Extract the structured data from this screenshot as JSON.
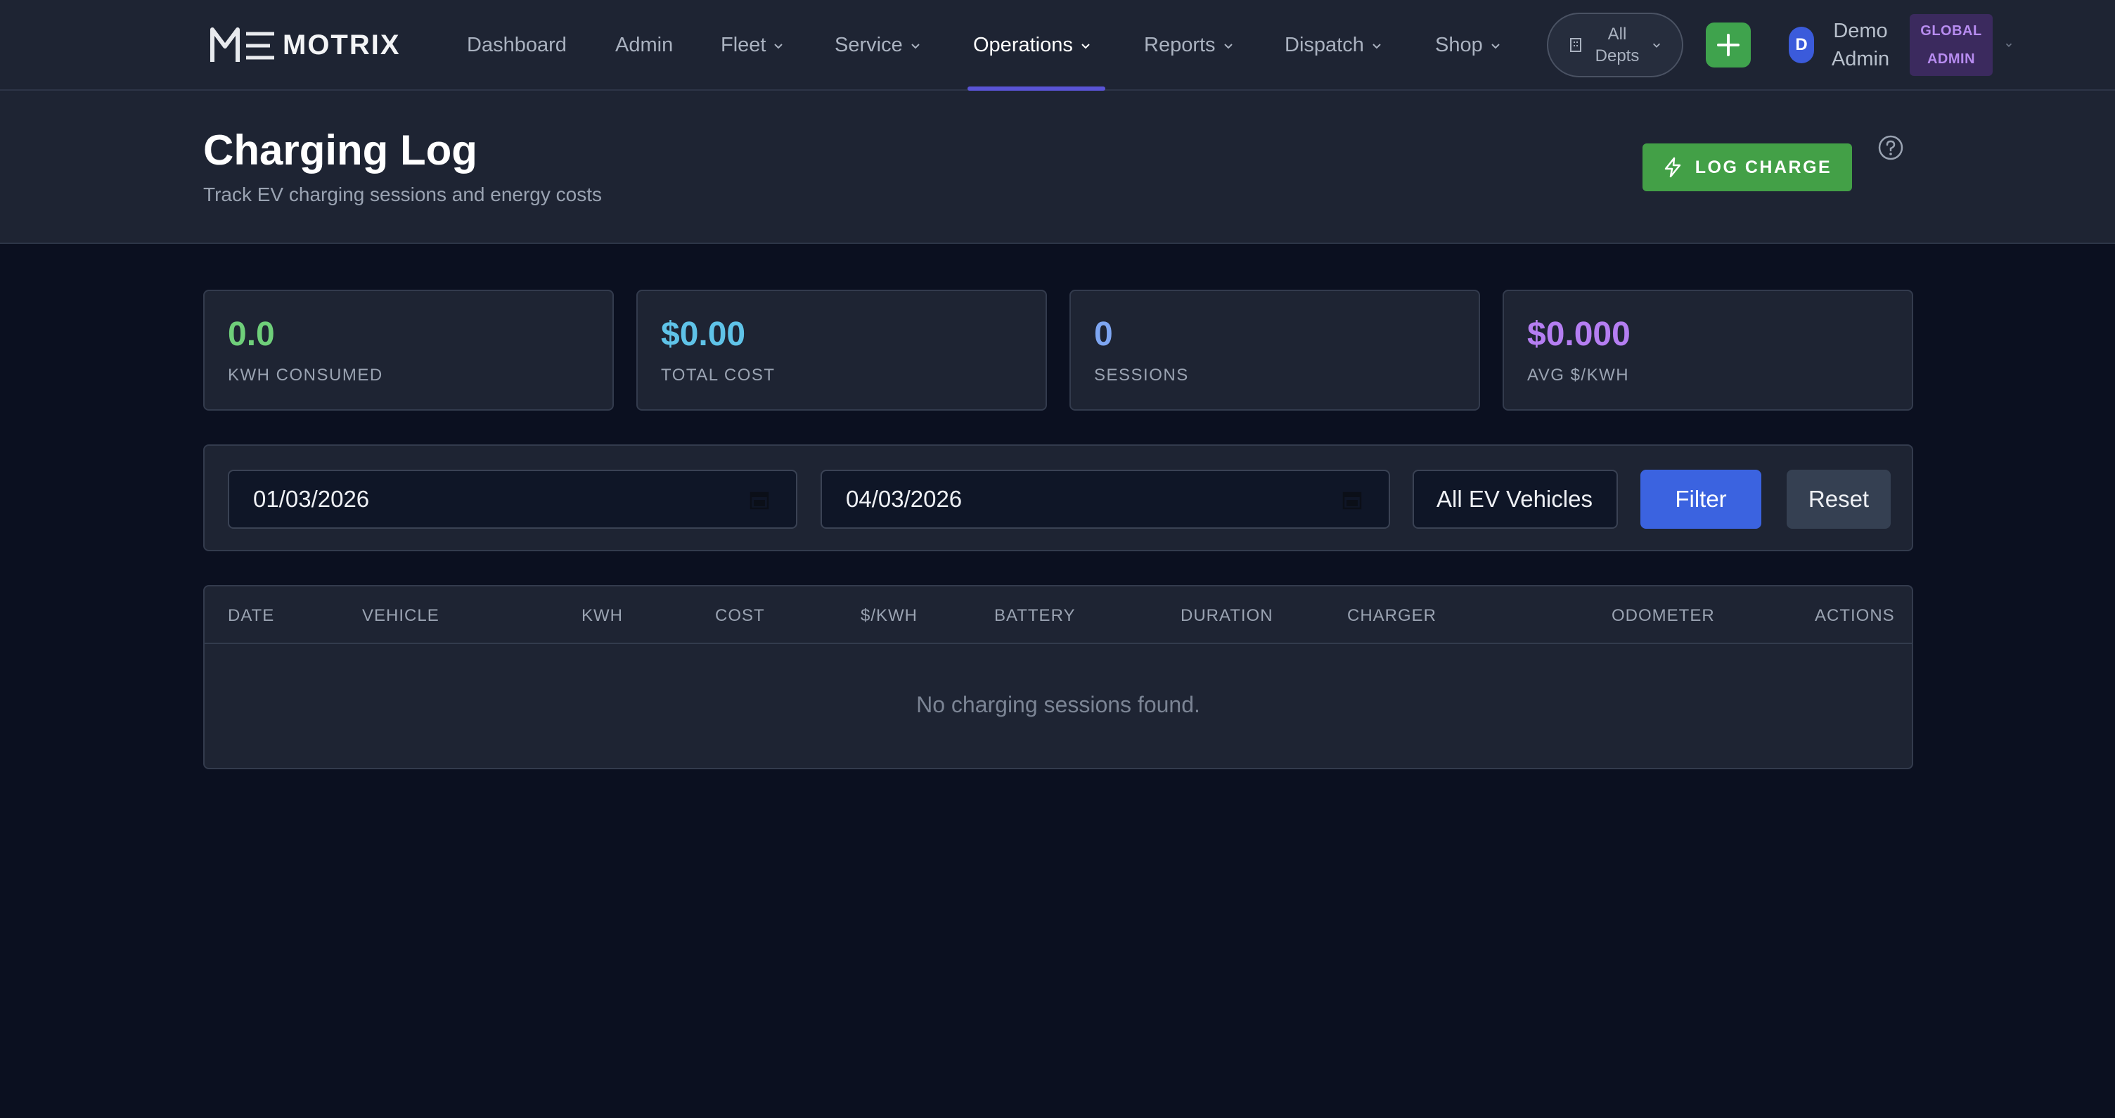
{
  "brand": {
    "name": "MOTRIX"
  },
  "nav": {
    "items": [
      {
        "label": "Dashboard",
        "has_dropdown": false
      },
      {
        "label": "Admin",
        "has_dropdown": false
      },
      {
        "label": "Fleet",
        "has_dropdown": true
      },
      {
        "label": "Service",
        "has_dropdown": true
      },
      {
        "label": "Operations",
        "has_dropdown": true,
        "active": true
      },
      {
        "label": "Reports",
        "has_dropdown": true
      },
      {
        "label": "Dispatch",
        "has_dropdown": true
      },
      {
        "label": "Shop",
        "has_dropdown": true
      }
    ],
    "dept_selector": {
      "line1": "All",
      "line2": "Depts"
    },
    "user": {
      "initial": "D",
      "name_line1": "Demo",
      "name_line2": "Admin",
      "role_line1": "GLOBAL",
      "role_line2": "ADMIN"
    }
  },
  "page": {
    "title": "Charging Log",
    "subtitle": "Track EV charging sessions and energy costs",
    "primary_action": "LOG CHARGE"
  },
  "stats": [
    {
      "value": "0.0",
      "label": "KWH CONSUMED",
      "color": "#6fcf7a"
    },
    {
      "value": "$0.00",
      "label": "TOTAL COST",
      "color": "#5fc3e8"
    },
    {
      "value": "0",
      "label": "SESSIONS",
      "color": "#7ea6f2"
    },
    {
      "value": "$0.000",
      "label": "AVG $/KWH",
      "color": "#b57ef2"
    }
  ],
  "filters": {
    "start_date": "01/03/2026",
    "end_date": "04/03/2026",
    "vehicle_select": "All EV Vehicles",
    "filter_label": "Filter",
    "reset_label": "Reset"
  },
  "table": {
    "columns": [
      "DATE",
      "VEHICLE",
      "KWH",
      "COST",
      "$/KWH",
      "BATTERY",
      "DURATION",
      "CHARGER",
      "ODOMETER",
      "ACTIONS"
    ],
    "empty_message": "No charging sessions found."
  },
  "colors": {
    "accent": "#5a54d6",
    "success": "#43a047",
    "primary": "#3b63e0"
  }
}
